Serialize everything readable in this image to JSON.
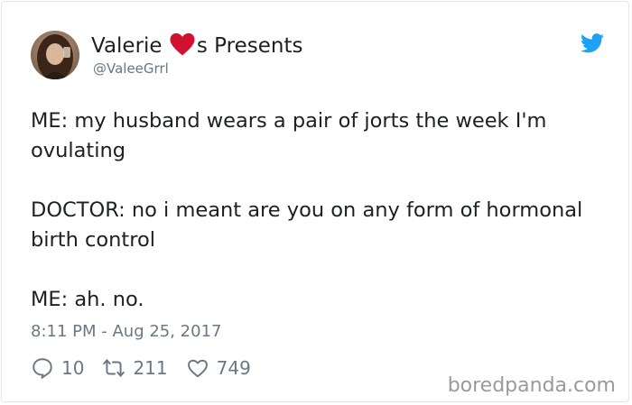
{
  "tweet": {
    "author": {
      "name_before": "Valerie ",
      "name_after": "s Presents",
      "handle": "@ValeeGrrl"
    },
    "text": [
      "ME: my husband wears a pair of jorts the week I'm ovulating",
      "DOCTOR: no i meant are you on any form of hormonal birth control",
      "ME: ah. no."
    ],
    "timestamp": "8:11 PM - Aug 25, 2017",
    "stats": {
      "replies": "10",
      "retweets": "211",
      "likes": "749"
    }
  },
  "icons": {
    "heart_emoji": "red-heart",
    "twitter_logo": "twitter-bird",
    "reply": "speech-bubble",
    "retweet": "retweet-arrows",
    "like": "heart-outline"
  },
  "colors": {
    "twitter_blue": "#1da1f2",
    "heart_red": "#d1112f",
    "meta_gray": "#697882",
    "text": "#1c2022"
  },
  "watermark": "boredpanda.com"
}
